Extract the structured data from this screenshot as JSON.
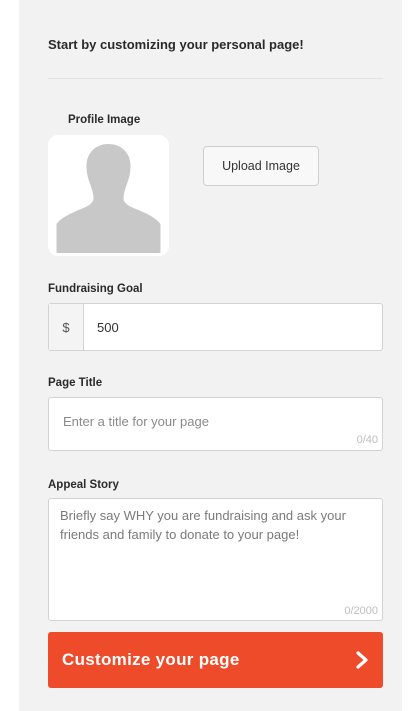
{
  "intro": {
    "heading": "Start by customizing your personal page!"
  },
  "profile": {
    "label": "Profile Image",
    "upload_label": "Upload Image"
  },
  "goal": {
    "label": "Fundraising Goal",
    "currency": "$",
    "value": "500"
  },
  "page_title": {
    "label": "Page Title",
    "placeholder": "Enter a title for your page",
    "counter": "0/40"
  },
  "appeal_story": {
    "label": "Appeal Story",
    "placeholder": "Briefly say WHY you are fundraising and ask your friends and family to donate to your page!",
    "counter": "0/2000"
  },
  "cta": {
    "label": "Customize your page",
    "icon": "chevron-right-icon"
  },
  "colors": {
    "accent": "#ee4b2b",
    "panel": "#f2f2f2",
    "border": "#d3d3d3"
  }
}
